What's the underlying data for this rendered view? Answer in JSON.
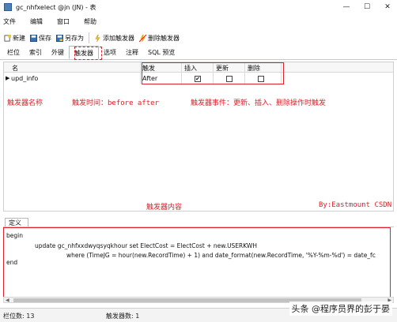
{
  "window": {
    "title": "gc_nhfxelect @jn (JN) - 表",
    "controls": {
      "minimize": "—",
      "maximize": "☐",
      "close": "✕"
    }
  },
  "menu": {
    "items": [
      "文件",
      "编辑",
      "窗口",
      "帮助"
    ]
  },
  "toolbar": {
    "new_label": "新建",
    "save_label": "保存",
    "save_as_label": "另存为",
    "add_trigger_label": "添加触发器",
    "delete_trigger_label": "删除触发器"
  },
  "tabs": [
    {
      "label": "栏位"
    },
    {
      "label": "索引"
    },
    {
      "label": "外键"
    },
    {
      "label": "触发器"
    },
    {
      "label": "选项"
    },
    {
      "label": "注释"
    },
    {
      "label": "SQL 预览"
    }
  ],
  "trigger_grid": {
    "headers": {
      "name": "名",
      "timing": "触发",
      "insert": "插入",
      "update": "更新",
      "delete": "删除"
    },
    "rows": [
      {
        "name": "upd_info",
        "timing": "After",
        "insert": "✔",
        "update": "",
        "delete": ""
      }
    ]
  },
  "annotations": {
    "trigger_name": "触发器名称",
    "trigger_time": "触发时间：before after",
    "trigger_event": "触发器事件：更新、插入、删除操作时触发",
    "trigger_content": "触发器内容",
    "author": "By:Eastmount CSDN"
  },
  "definition": {
    "tab_label": "定义",
    "lines": [
      "begin",
      "update gc_nhfxxdwyqsyqkhour set ElectCost = ElectCost + new.USERKWH",
      "where (TimeJG = hour(new.RecordTime) + 1) and date_format(new.RecordTime, '%Y-%m-%d') = date_fc",
      "end"
    ]
  },
  "scrollbar": {
    "left_arrow": "◀",
    "right_arrow": "▶"
  },
  "status": {
    "field_count": "栏位数: 13",
    "trigger_count": "触发器数: 1"
  },
  "watermark": "头条 @程序员界的彭于晏",
  "colors": {
    "annotation": "#e0202a",
    "accent": "#4f7fb8"
  }
}
